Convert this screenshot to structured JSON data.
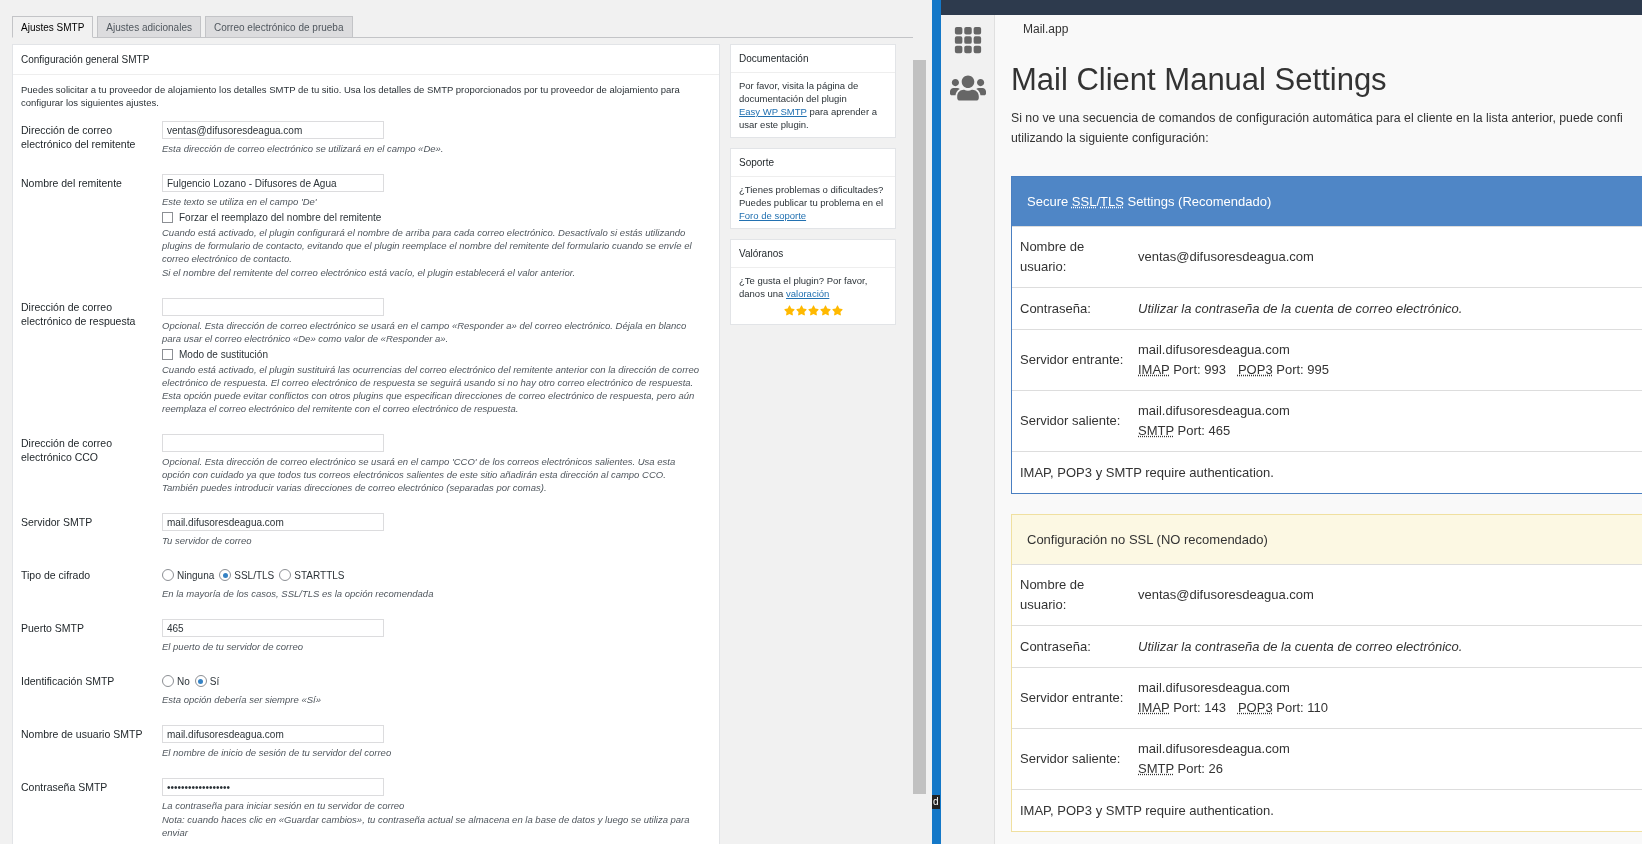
{
  "tabs": [
    {
      "label": "Ajustes SMTP",
      "selected": true
    },
    {
      "label": "Ajustes adicionales",
      "selected": false
    },
    {
      "label": "Correo electrónico de prueba",
      "selected": false
    }
  ],
  "settings": {
    "title": "Configuración general SMTP",
    "intro": "Puedes solicitar a tu proveedor de alojamiento los detalles SMTP de tu sitio. Usa los detalles de SMTP proporcionados por tu proveedor de alojamiento para configurar los siguientes ajustes.",
    "fields": [
      {
        "kind": "text",
        "label": "Dirección de correo electrónico del remitente",
        "value": "ventas@difusoresdeagua.com",
        "hint": "Esta dirección de correo electrónico se utilizará en el campo «De»."
      },
      {
        "kind": "text",
        "label": "Nombre del remitente",
        "value": "Fulgencio Lozano - Difusores de Agua",
        "hint": "Este texto se utiliza en el campo 'De'",
        "checkbox": {
          "label": "Forzar el reemplazo del nombre del remitente",
          "checked": false
        },
        "notes": [
          "Cuando está activado, el plugin configurará el nombre de arriba para cada correo electrónico. Desactívalo si estás utilizando plugins de formulario de contacto, evitando que el plugin reemplace el nombre del remitente del formulario cuando se envíe el correo electrónico de contacto.",
          "Si el nombre del remitente del correo electrónico está vacío, el plugin establecerá el valor anterior."
        ]
      },
      {
        "kind": "text",
        "label": "Dirección de correo electrónico de respuesta",
        "hint": "Opcional. Esta dirección de correo electrónico se usará en el campo «Responder a» del correo electrónico. Déjala en blanco para usar el correo electrónico «De» como valor de «Responder a».",
        "checkbox": {
          "label": "Modo de sustitución",
          "checked": false
        },
        "notes": [
          "Cuando está activado, el plugin sustituirá las ocurrencias del correo electrónico del remitente anterior con la dirección de correo electrónico de respuesta. El correo electrónico de respuesta se seguirá usando si no hay otro correo electrónico de respuesta. Esta opción puede evitar conflictos con otros plugins que especifican direcciones de correo electrónico de respuesta, pero aún reemplaza el correo electrónico del remitente con el correo electrónico de respuesta."
        ]
      },
      {
        "kind": "text",
        "label": "Dirección de correo electrónico CCO",
        "hint": "Opcional. Esta dirección de correo electrónico se usará en el campo 'CCO' de los correos electrónicos salientes. Usa esta opción con cuidado ya que todos tus correos electrónicos salientes de este sitio añadirán esta dirección al campo CCO. También puedes introducir varias direcciones de correo electrónico (separadas por comas)."
      },
      {
        "kind": "text",
        "label": "Servidor SMTP",
        "value": "mail.difusoresdeagua.com",
        "hint": "Tu servidor de correo"
      },
      {
        "kind": "radio",
        "label": "Tipo de cifrado",
        "options": [
          {
            "label": "Ninguna",
            "selected": false
          },
          {
            "label": "SSL/TLS",
            "selected": true
          },
          {
            "label": "STARTTLS",
            "selected": false
          }
        ],
        "hint": "En la mayoría de los casos, SSL/TLS es la opción recomendada"
      },
      {
        "kind": "text",
        "label": "Puerto SMTP",
        "value": "465",
        "hint": "El puerto de tu servidor de correo"
      },
      {
        "kind": "radio",
        "label": "Identificación SMTP",
        "options": [
          {
            "label": "No",
            "selected": false
          },
          {
            "label": "Sí",
            "selected": true
          }
        ],
        "hint": "Esta opción debería ser siempre «Sí»"
      },
      {
        "kind": "text",
        "label": "Nombre de usuario SMTP",
        "value": "mail.difusoresdeagua.com",
        "hint": "El nombre de inicio de sesión de tu servidor del correo"
      },
      {
        "kind": "text",
        "label": "Contraseña SMTP",
        "value": "••••••••••••••••••",
        "hint": "La contraseña para iniciar sesión en tu servidor de correo",
        "notes": [
          "Nota: cuando haces clic en «Guardar cambios», tu contraseña actual se almacena en la base de datos y luego se utiliza para enviar"
        ]
      }
    ]
  },
  "sidebar": [
    {
      "title": "Documentación",
      "before": "Por favor, visita la página de documentación del plugin ",
      "link": "Easy WP SMTP",
      "after": " para aprender a usar este plugin."
    },
    {
      "title": "Soporte",
      "before": "¿Tienes problemas o dificultades? Puedes publicar tu problema en el ",
      "link": "Foro de soporte"
    },
    {
      "title": "Valóranos",
      "before": "¿Te gusta el plugin? Por favor, danos una ",
      "link": "valoración",
      "stars": 5
    }
  ],
  "divider_tooltip": "d",
  "mail_app": {
    "breadcrumb": "Mail.app",
    "title": "Mail Client Manual Settings",
    "intro": [
      "Si no ve una secuencia de comandos de configuración automática para el cliente en la lista anterior, puede confi",
      "utilizando la siguiente configuración:"
    ],
    "panels": [
      {
        "kind": "secure",
        "header": [
          {
            "text": "Secure "
          },
          {
            "abbr": "SSL"
          },
          {
            "text": "/"
          },
          {
            "abbr": "TLS"
          },
          {
            "text": " Settings (Recomendado)"
          }
        ],
        "rows": [
          {
            "kind": "text",
            "label": "Nombre de usuario:",
            "value": "ventas@difusoresdeagua.com"
          },
          {
            "kind": "italic",
            "label": "Contraseña:",
            "value": "Utilizar la contraseña de la cuenta de correo electrónico."
          },
          {
            "kind": "server",
            "label": "Servidor entrante:",
            "host": "mail.difusoresdeagua.com",
            "ports": [
              {
                "protocol": "IMAP",
                "port": "Port: 993"
              },
              {
                "protocol": "POP3",
                "port": "Port: 995"
              }
            ]
          },
          {
            "kind": "server",
            "label": "Servidor saliente:",
            "host": "mail.difusoresdeagua.com",
            "ports": [
              {
                "protocol": "SMTP",
                "port": "Port: 465"
              }
            ]
          }
        ],
        "footer": "IMAP, POP3 y SMTP require authentication."
      },
      {
        "kind": "plain",
        "header": [
          {
            "text": "Configuración no SSL (NO recomendado)"
          }
        ],
        "rows": [
          {
            "kind": "text",
            "label": "Nombre de usuario:",
            "value": "ventas@difusoresdeagua.com"
          },
          {
            "kind": "italic",
            "label": "Contraseña:",
            "value": "Utilizar la contraseña de la cuenta de correo electrónico."
          },
          {
            "kind": "server",
            "label": "Servidor entrante:",
            "host": "mail.difusoresdeagua.com",
            "ports": [
              {
                "protocol": "IMAP",
                "port": "Port: 143"
              },
              {
                "protocol": "POP3",
                "port": "Port: 110"
              }
            ]
          },
          {
            "kind": "server",
            "label": "Servidor saliente:",
            "host": "mail.difusoresdeagua.com",
            "ports": [
              {
                "protocol": "SMTP",
                "port": "Port: 26"
              }
            ]
          }
        ],
        "footer": "IMAP, POP3 y SMTP require authentication."
      }
    ]
  }
}
